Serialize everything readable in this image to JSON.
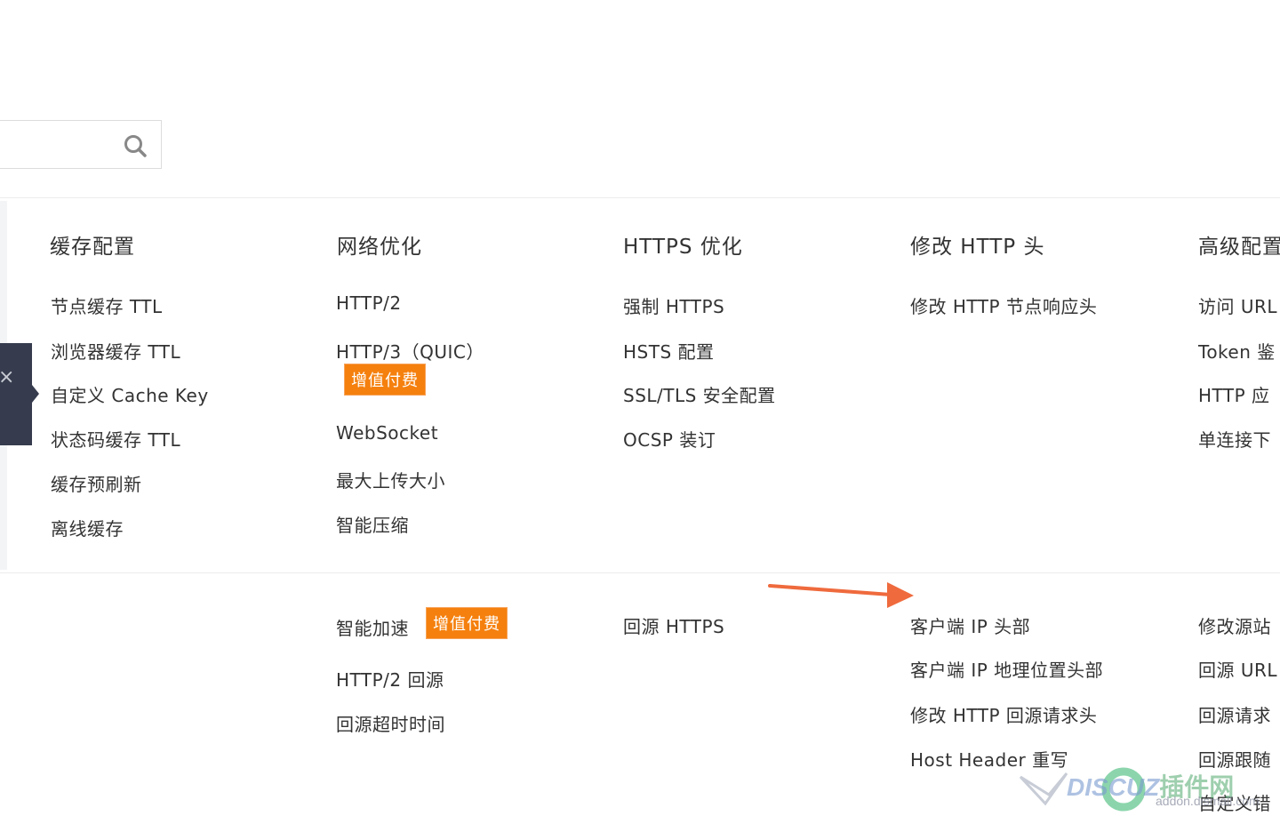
{
  "search": {
    "placeholder": "",
    "value": ""
  },
  "columns": [
    {
      "heading": "缓存配置",
      "items": [
        "节点缓存 TTL",
        "浏览器缓存 TTL",
        "自定义 Cache Key",
        "状态码缓存 TTL",
        "缓存预刷新",
        "离线缓存"
      ]
    },
    {
      "heading": "网络优化",
      "items": [
        "HTTP/2",
        "HTTP/3（QUIC）",
        "WebSocket",
        "最大上传大小",
        "智能压缩"
      ],
      "badge": "增值付费"
    },
    {
      "heading": "HTTPS 优化",
      "items": [
        "强制 HTTPS",
        "HSTS 配置",
        "SSL/TLS 安全配置",
        "OCSP 装订"
      ]
    },
    {
      "heading": "修改 HTTP 头",
      "items": [
        "修改 HTTP 节点响应头"
      ]
    },
    {
      "heading": "高级配置",
      "items": [
        "访问 URL",
        "Token 鉴",
        "HTTP 应",
        "单连接下"
      ]
    }
  ],
  "origin_row": {
    "col2": [
      "智能加速",
      "HTTP/2 回源",
      "回源超时时间"
    ],
    "col2_badge": "增值付费",
    "col3": [
      "回源 HTTPS"
    ],
    "col4": [
      "客户端 IP 头部",
      "客户端 IP 地理位置头部",
      "修改 HTTP 回源请求头",
      "Host Header 重写"
    ],
    "col5": [
      "修改源站",
      "回源 URL",
      "回源请求",
      "回源跟随",
      "自定义错"
    ]
  },
  "collapse_tab": {
    "icon": "close-icon",
    "glyph": "×"
  },
  "watermark": {
    "text": "DISCUZ",
    "cn": "插件网",
    "sub": "addon.dismall.com"
  },
  "colors": {
    "badge": "#f5800e",
    "arrow": "#ef6a3d",
    "tab": "#363c4e"
  }
}
